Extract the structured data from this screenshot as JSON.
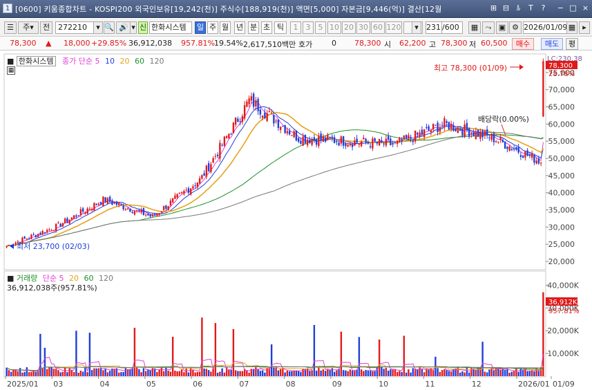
{
  "window": {
    "number": "1",
    "title": "[0600] 키움종합차트 - KOSPI200 외국인보유[19,242(천)] 주식수[188,919(천)] 액면[5,000] 자본금[9,446(억)] 결산[12월",
    "buttons": [
      "⊞",
      "⊟",
      "ﾙ",
      "T",
      "?",
      "−",
      "□",
      "×"
    ]
  },
  "toolbar": {
    "market": "주",
    "prev": "전",
    "code": "272210",
    "stock_name": "한화시스템",
    "new_badge": "신",
    "periods": [
      "일",
      "주",
      "월",
      "년",
      "분",
      "초",
      "틱"
    ],
    "selected_period": "일",
    "intervals": [
      "1",
      "3",
      "5",
      "10",
      "20",
      "30",
      "60",
      "120"
    ],
    "count": "231",
    "count_max": "/600",
    "date": "2026/01/09"
  },
  "quote": {
    "price": "78,300",
    "change": "18,000",
    "change_pct": "+29.85%",
    "volume": "36,912,038",
    "volume_pct": "957.81%",
    "turnover_pct": "19.54%",
    "amount": "2,617,510백만",
    "hoga_label": "호가",
    "hoga_value": "0",
    "bid": "78,300",
    "open_label": "시",
    "open": "62,200",
    "high_label": "고",
    "high": "78,300",
    "low_label": "저",
    "low": "60,500",
    "buy_btn": "매수",
    "sell_btn": "매도",
    "eval_btn": "평"
  },
  "price_panel": {
    "stock_label": "한화시스템",
    "ma_title": "종가 단순",
    "ma_periods": [
      "5",
      "10",
      "20",
      "60",
      "120"
    ],
    "ma_colors": [
      "#e23bd6",
      "#1f3fd8",
      "#e8a21c",
      "#1c8f2a",
      "#777777"
    ],
    "max_note": "최고 78,300 (01/09)",
    "min_note": "최저 23,700 (02/03)",
    "dividend_note": "배당락(0.00%)",
    "lc_tag": "LC:230.38",
    "price_tag": "78,300",
    "pct_tag": "28.78%",
    "y_ticks": [
      "75,000",
      "70,000",
      "65,000",
      "60,000",
      "55,000",
      "50,000",
      "45,000",
      "40,000",
      "35,000",
      "30,000",
      "25,000",
      "20,000"
    ]
  },
  "volume_panel": {
    "label": "거래량",
    "ma_title": "단순",
    "ma_periods": [
      "5",
      "20",
      "60",
      "120"
    ],
    "current": "36,912,038주(957.81%)",
    "vol_tag": "36,912K",
    "vol_pct_tag": "957.81%",
    "y_ticks": [
      "40,000K",
      "30,000K",
      "20,000K",
      "10,000K"
    ]
  },
  "x_axis": [
    "2025/01",
    "03",
    "04",
    "05",
    "06",
    "07",
    "08",
    "09",
    "10",
    "11",
    "12",
    "2026/01",
    "01/09"
  ],
  "chart_data": {
    "type": "candlestick",
    "x": [
      "2025-01",
      "2025-02",
      "2025-03",
      "2025-04",
      "2025-05",
      "2025-06",
      "2025-07",
      "2025-08",
      "2025-09",
      "2025-10",
      "2025-11",
      "2025-12",
      "2026-01"
    ],
    "close_path": [
      24500,
      30000,
      38000,
      33000,
      44000,
      67000,
      56000,
      55000,
      54000,
      60000,
      56000,
      49000,
      78300
    ],
    "price_max": 78300,
    "price_min": 23700,
    "ylim": [
      18000,
      80000
    ],
    "volume_ylim": [
      0,
      45000000
    ]
  }
}
